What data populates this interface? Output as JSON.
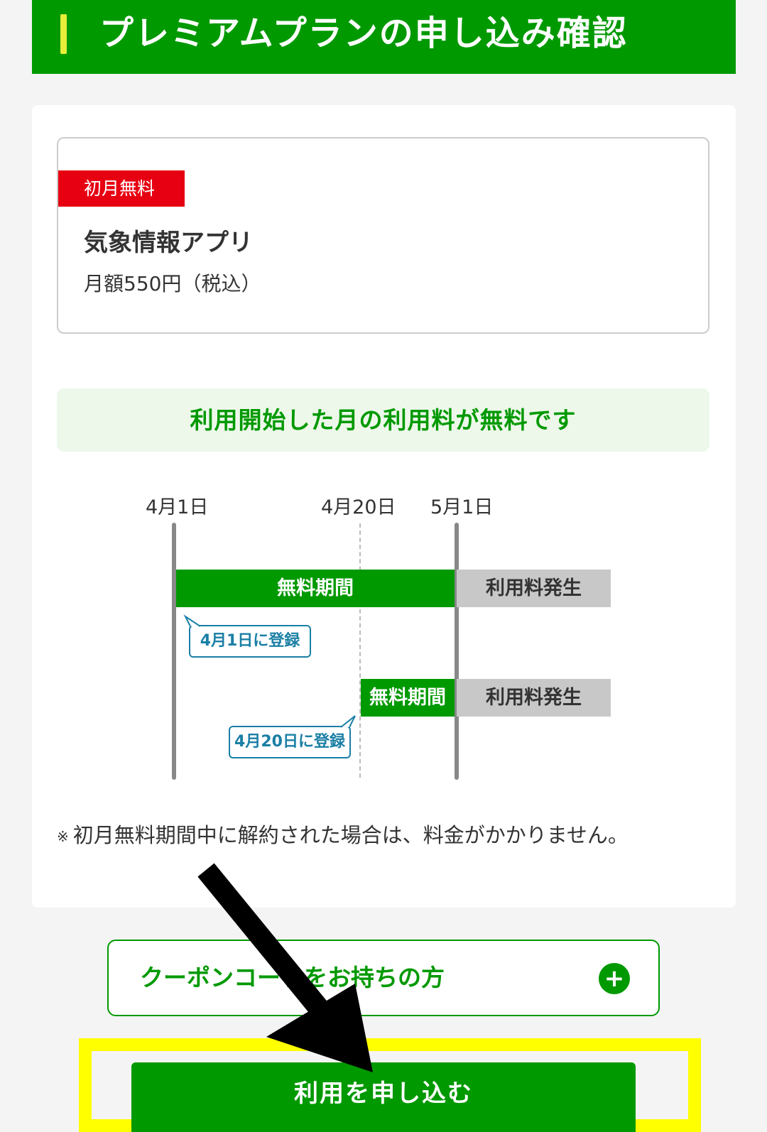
{
  "header": {
    "title": "プレミアムプランの申し込み確認",
    "accent_color": "#e6ee3a",
    "bg_color": "#009900"
  },
  "plan": {
    "badge": "初月無料",
    "name": "気象情報アプリ",
    "price": "月額550円（税込）"
  },
  "info_banner": "利用開始した月の利用料が無料です",
  "timeline": {
    "dates": [
      "4月1日",
      "4月20日",
      "5月1日"
    ],
    "row1": {
      "free_label": "無料期間",
      "paid_label": "利用料発生",
      "bubble": "4月1日に登録"
    },
    "row2": {
      "free_label": "無料期間",
      "paid_label": "利用料発生",
      "bubble": "4月20日に登録"
    }
  },
  "note": {
    "mark": "※",
    "text": "初月無料期間中に解約された場合は、料金がかかりません。"
  },
  "coupon": {
    "label": "クーポンコードをお持ちの方",
    "icon": "plus-icon"
  },
  "apply_button": {
    "label": "利用を申し込む"
  }
}
